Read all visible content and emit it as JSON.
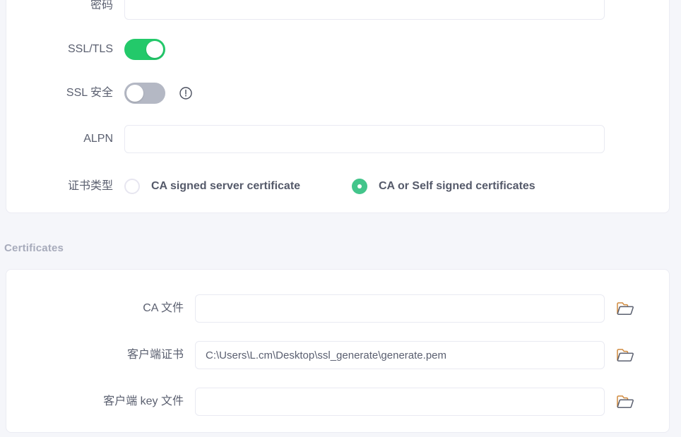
{
  "page": {
    "background_color": "#f5f6fa",
    "card_color": "#ffffff"
  },
  "colors": {
    "toggle_on": "#23c96a",
    "toggle_off": "#b4b8c4",
    "radio_selected": "#43c58b",
    "label_text": "#5b6070",
    "section_title": "#a7abbb",
    "input_border": "#e9eaf2"
  },
  "connection_section": {
    "rows": [
      {
        "id": "password",
        "label": "密码",
        "type": "input",
        "value": "",
        "placeholder": ""
      },
      {
        "id": "ssl-tls",
        "label": "SSL/TLS",
        "type": "toggle",
        "state": "on"
      },
      {
        "id": "ssl-secure",
        "label": "SSL 安全",
        "type": "toggle",
        "state": "off",
        "info_icon": "exclamation-circle-icon"
      },
      {
        "id": "alpn",
        "label": "ALPN",
        "type": "input",
        "value": "",
        "placeholder": ""
      },
      {
        "id": "cert-type",
        "label": "证书类型",
        "type": "radio-group",
        "options": [
          {
            "label": "CA signed server certificate",
            "selected": false
          },
          {
            "label": "CA or Self signed certificates",
            "selected": true
          }
        ]
      }
    ]
  },
  "certificates_section": {
    "title": "Certificates",
    "rows": [
      {
        "id": "ca-file",
        "label": "CA 文件",
        "value": "",
        "placeholder": "",
        "browse_icon": "folder-open-icon"
      },
      {
        "id": "client-cert",
        "label": "客户端证书",
        "value": "C:\\Users\\L.cm\\Desktop\\ssl_generate\\generate.pem",
        "placeholder": "",
        "browse_icon": "folder-open-icon"
      },
      {
        "id": "client-key",
        "label": "客户端 key 文件",
        "value": "",
        "placeholder": "",
        "browse_icon": "folder-open-icon"
      }
    ]
  }
}
